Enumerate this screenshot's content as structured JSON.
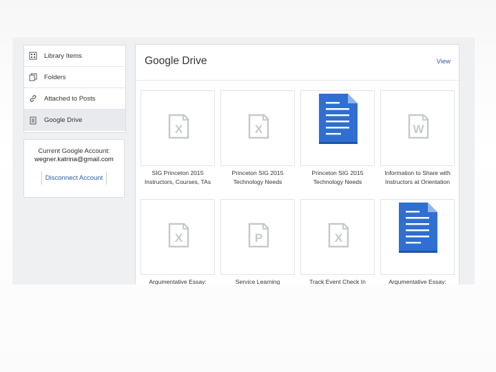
{
  "sidebar": {
    "items": [
      {
        "label": "Library Items",
        "icon": "grid-icon"
      },
      {
        "label": "Folders",
        "icon": "folders-icon"
      },
      {
        "label": "Attached to Posts",
        "icon": "link-icon"
      },
      {
        "label": "Google Drive",
        "icon": "document-icon",
        "active": true
      }
    ]
  },
  "account": {
    "label": "Current Google Account:",
    "email": "wegner.katrina@gmail.com",
    "disconnect_label": "Disconnect Account"
  },
  "main": {
    "title": "Google Drive",
    "view_label": "View",
    "files": [
      {
        "line1": "SIG Princeton 2015",
        "line2": "Instructors, Courses, TAs",
        "type": "x",
        "icon": "excel-file-icon"
      },
      {
        "line1": "Princeton SIG 2015",
        "line2": "Technology Needs",
        "type": "x",
        "icon": "excel-file-icon"
      },
      {
        "line1": "Princeton SIG 2015",
        "line2": "Technology Needs",
        "type": "doc",
        "icon": "google-doc-icon"
      },
      {
        "line1": "Information to Share with",
        "line2": "Instructors at Orientation",
        "type": "w",
        "icon": "word-file-icon"
      },
      {
        "line1": "Argumentative Essay:",
        "line2": "",
        "type": "x",
        "icon": "excel-file-icon"
      },
      {
        "line1": "Service Learning",
        "line2": "",
        "type": "p",
        "icon": "powerpoint-file-icon"
      },
      {
        "line1": "Track Event Check In",
        "line2": "",
        "type": "x",
        "icon": "excel-file-icon"
      },
      {
        "line1": "Argumentative Essay:",
        "line2": "",
        "type": "doc",
        "icon": "google-doc-icon"
      }
    ]
  },
  "colors": {
    "doc_blue": "#2e6fd1",
    "link_blue": "#2a5d9f",
    "placeholder_gray": "#c6c9cc"
  }
}
